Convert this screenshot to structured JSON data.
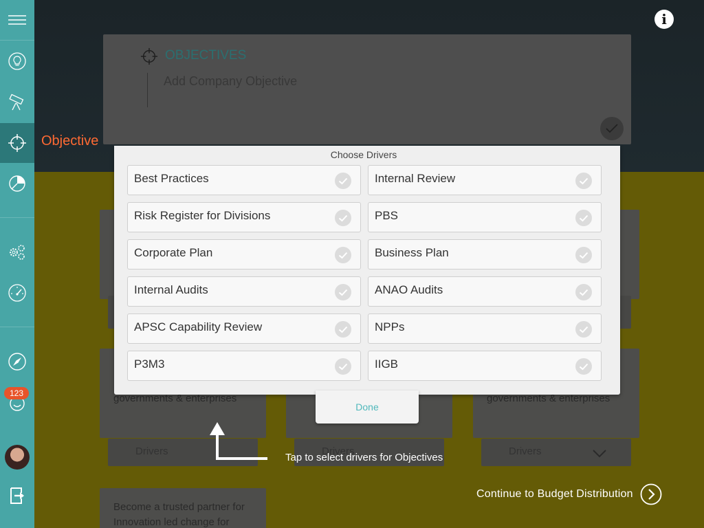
{
  "sidebar": {
    "badge_count": "123"
  },
  "header": {
    "objective_label": "Objective",
    "info_label": "i"
  },
  "objectives_panel": {
    "title": "OBJECTIVES",
    "placeholder": "Add Company Objective"
  },
  "background_cards": {
    "card_text": "governments & enterprises",
    "driver_label": "Drivers",
    "bottom_card_line1": "Become a trusted partner for",
    "bottom_card_line2": "Innovation led change for"
  },
  "modal": {
    "title": "Choose Drivers",
    "done_label": "Done",
    "drivers": [
      {
        "label": "Best Practices"
      },
      {
        "label": "Internal Review"
      },
      {
        "label": "Risk Register for Divisions"
      },
      {
        "label": "PBS"
      },
      {
        "label": "Corporate Plan"
      },
      {
        "label": "Business Plan"
      },
      {
        "label": "Internal Audits"
      },
      {
        "label": "ANAO Audits"
      },
      {
        "label": "APSC Capability Review"
      },
      {
        "label": "NPPs"
      },
      {
        "label": "P3M3"
      },
      {
        "label": "IIGB"
      }
    ]
  },
  "hint": {
    "text": "Tap to select drivers for Objectives"
  },
  "footer": {
    "continue_label": "Continue to Budget Distribution"
  },
  "colors": {
    "sidebar": "#48a6a6",
    "sidebar_active": "#2c7879",
    "accent_orange": "#ff6a33",
    "badge": "#e8542a",
    "done_text": "#4fb8bb"
  },
  "icons": {
    "menu": "hamburger-icon",
    "ideas": "lightbulb-icon",
    "vision": "telescope-icon",
    "objective": "target-icon",
    "budget": "pie-chart-icon",
    "settings": "gears-icon",
    "performance": "speedometer-icon",
    "explore": "compass-icon",
    "feedback": "smiley-icon",
    "logout": "logout-icon"
  }
}
